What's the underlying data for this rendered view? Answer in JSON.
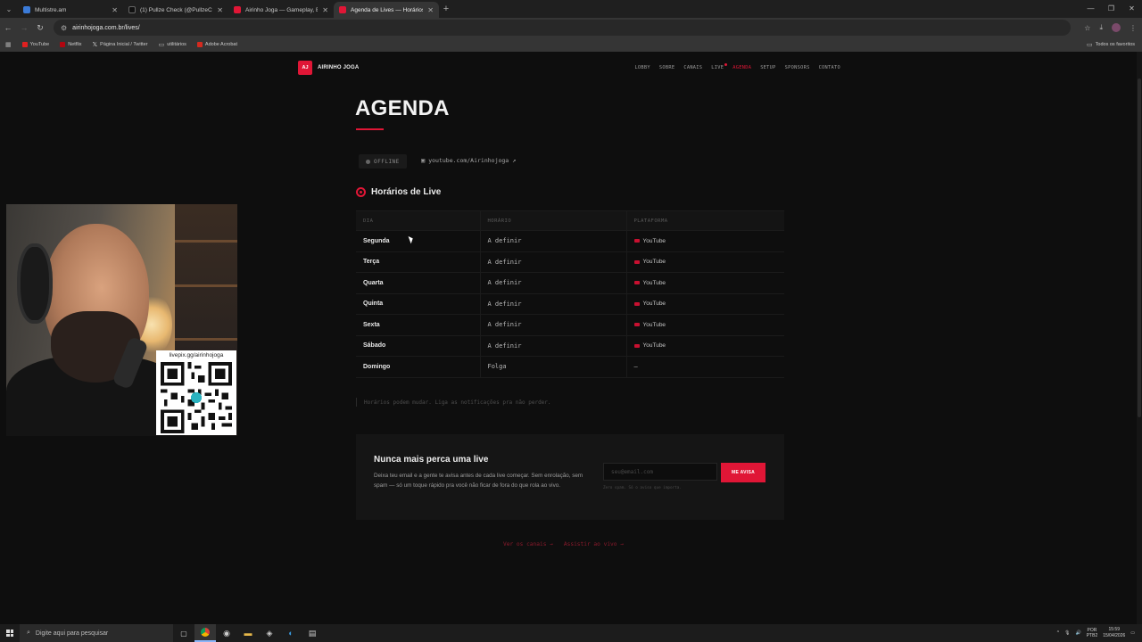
{
  "browser": {
    "tabs": [
      {
        "title": "Multistre.am",
        "color": "#3b7bd8",
        "active": false
      },
      {
        "title": "(1) Pullze Check (@PullzeCheck",
        "color": "#111111",
        "active": false
      },
      {
        "title": "Airinho Joga — Gameplay, Entr",
        "color": "#e01636",
        "active": false
      },
      {
        "title": "Agenda de Lives — Horários d",
        "color": "#e01636",
        "active": true
      }
    ],
    "url": "airinhojoga.com.br/lives/",
    "bookmarks": [
      {
        "label": "YouTube",
        "color": "#e02020"
      },
      {
        "label": "Netflix",
        "color": "#b00610"
      },
      {
        "label": "Página Inicial / Twitter",
        "color": "#111111"
      },
      {
        "label": "utilitários",
        "color": "#999999"
      },
      {
        "label": "Adobe Acrobat",
        "color": "#d42a1f"
      }
    ],
    "bookmarks_right": "Todos os favoritos"
  },
  "site": {
    "logo_mark": "AJ",
    "logo_text": "AIRINHO JOGA",
    "nav": [
      "LOBBY",
      "SOBRE",
      "CANAIS",
      "LIVE",
      "AGENDA",
      "SETUP",
      "SPONSORS",
      "CONTATO"
    ],
    "nav_active": "AGENDA",
    "accent": "#e01636"
  },
  "agenda": {
    "title": "AGENDA",
    "status": "OFFLINE",
    "channel_link": "youtube.com/Airinhojoga",
    "section_title": "Horários de Live",
    "columns": [
      "DIA",
      "HORÁRIO",
      "PLATAFORMA"
    ],
    "rows": [
      {
        "day": "Segunda",
        "time": "A definir",
        "platform": "YouTube"
      },
      {
        "day": "Terça",
        "time": "A definir",
        "platform": "YouTube"
      },
      {
        "day": "Quarta",
        "time": "A definir",
        "platform": "YouTube"
      },
      {
        "day": "Quinta",
        "time": "A definir",
        "platform": "YouTube"
      },
      {
        "day": "Sexta",
        "time": "A definir",
        "platform": "YouTube"
      },
      {
        "day": "Sábado",
        "time": "A definir",
        "platform": "YouTube"
      },
      {
        "day": "Domingo",
        "time": "Folga",
        "platform": "—"
      }
    ],
    "note": "Horários podem mudar. Liga as notificações pra não perder."
  },
  "newsletter": {
    "title": "Nunca mais perca uma live",
    "text": "Deixa teu email e a gente te avisa antes de cada live começar. Sem enrolação, sem spam — só um toque rápido pra você não ficar de fora do que rola ao vivo.",
    "placeholder": "seu@email.com",
    "button": "ME AVISA",
    "small": "Zero spam. Só o aviso que importa."
  },
  "bottom_links": [
    "Ver os canais →",
    "Assistir ao vivo →"
  ],
  "overlay": {
    "qr_label": "livepix.gg/airinhojoga"
  },
  "taskbar": {
    "search_placeholder": "Digite aqui para pesquisar",
    "lang_top": "POR",
    "lang_bottom": "PTB2",
    "time": "15:59",
    "date": "15/04/2026"
  }
}
